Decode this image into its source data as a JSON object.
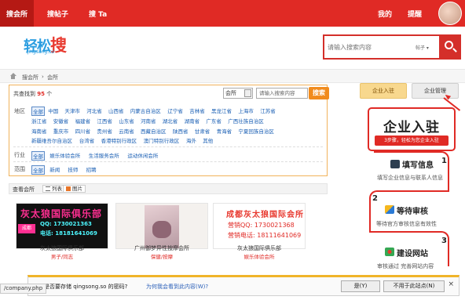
{
  "topnav": {
    "items": [
      "搜会所",
      "搜帖子",
      "搜 Ta"
    ],
    "right": [
      "我的",
      "提醒"
    ]
  },
  "logo": {
    "main_a": "轻松",
    "main_b": "搜",
    "sub": "qingsong.so"
  },
  "search": {
    "placeholder": "请输入搜索内容",
    "type": "帖子"
  },
  "breadcrumb": [
    "搜会所",
    "会所"
  ],
  "filter": {
    "found_prefix": "共查找到",
    "found_count": "95",
    "found_suffix": "个",
    "category_value": "会所",
    "keyword_placeholder": "请输入搜索内容",
    "search_label": "搜索",
    "region_label": "地区",
    "regions": [
      [
        "全部",
        "中国",
        "天津市",
        "河北省",
        "山西省",
        "内蒙古自治区",
        "辽宁省",
        "吉林省",
        "黑龙江省",
        "上海市",
        "江苏省"
      ],
      [
        "浙江省",
        "安徽省",
        "福建省",
        "江西省",
        "山东省",
        "河南省",
        "湖北省",
        "湖南省",
        "广东省",
        "广西壮族自治区"
      ],
      [
        "海南省",
        "重庆市",
        "四川省",
        "贵州省",
        "云南省",
        "西藏自治区",
        "陕西省",
        "甘肃省",
        "青海省",
        "宁夏回族自治区"
      ],
      [
        "新疆维吾尔自治区",
        "台湾省",
        "香港特别行政区",
        "澳门特别行政区",
        "海外",
        "其他"
      ]
    ],
    "industry_label": "行业",
    "industries": [
      "全部",
      "娱乐体验会所",
      "生活服务会所",
      "运动休闲会所"
    ],
    "scope_label": "范围",
    "scopes": [
      "全部",
      "新闻",
      "技师",
      "招聘"
    ]
  },
  "viewbar": {
    "label": "查看会所",
    "list": "列表",
    "image": "图片"
  },
  "cards": [
    {
      "title": "灰太狼国际俱乐部",
      "sub": "男子/同志",
      "img_big": "灰太狼国际俱乐部",
      "img_line1": "QQ: 1730021363",
      "img_line2": "电话: 18181641069",
      "img_neon": "成都"
    },
    {
      "title": "广州御梦异性按摩会所",
      "sub": "保健/按摩"
    },
    {
      "title": "灰太狼国际俱乐部",
      "sub": "娱乐体验会所",
      "img_big": "成都灰太狼国际会所",
      "img_line1": "营销QQ: 1730021368",
      "img_line2": "营销电话: 18111641069"
    }
  ],
  "sidebar": {
    "settle_btn": "企业入驻",
    "manage_btn": "企业管理",
    "promo_title": "企业入驻",
    "promo_bar": "3步骤，轻松为您企业入驻",
    "steps": [
      {
        "num": "1",
        "title": "填写信息",
        "desc": "填写企业信息与联系人信息"
      },
      {
        "num": "2",
        "title": "等待审核",
        "desc": "等待官方审核信息有效性"
      },
      {
        "num": "3",
        "title": "建设网站",
        "desc": "审核通过  完善网站内容"
      }
    ]
  },
  "status": {
    "url": "/company.php"
  },
  "infobar": {
    "msg": "是否要存储 qingsong.so 的密码?",
    "link": "为何我会看到此内容(W)?",
    "yes": "是(Y)",
    "never": "不用于此站点(N)",
    "close": "×"
  },
  "colors": {
    "brand_red": "#e02a25",
    "filter_border": "#f1b25b",
    "search_btn": "#f18b1c",
    "link": "#1a5fb4"
  }
}
